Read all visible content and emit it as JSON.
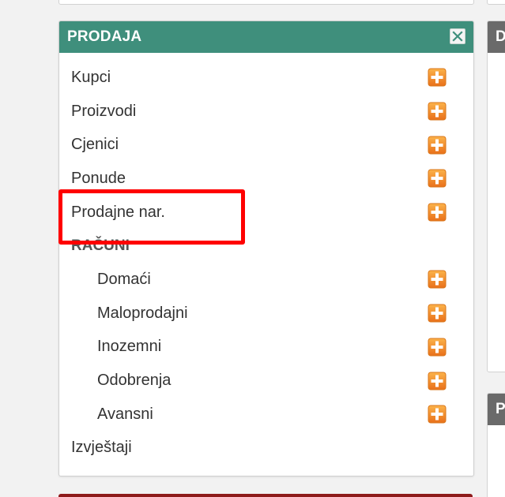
{
  "panel": {
    "title": "PRODAJA",
    "close_icon": "close-icon",
    "header_color": "#3f8f7c",
    "items": [
      {
        "label": "Kupci",
        "add_icon": "plus-icon",
        "type": "item"
      },
      {
        "label": "Proizvodi",
        "add_icon": "plus-icon",
        "type": "item"
      },
      {
        "label": "Cjenici",
        "add_icon": "plus-icon",
        "type": "item"
      },
      {
        "label": "Ponude",
        "add_icon": "plus-icon",
        "type": "item"
      },
      {
        "label": "Prodajne nar.",
        "add_icon": "plus-icon",
        "type": "item"
      },
      {
        "label": "RAČUNI",
        "type": "section"
      },
      {
        "label": "Domaći",
        "add_icon": "plus-icon",
        "type": "subitem"
      },
      {
        "label": "Maloprodajni",
        "add_icon": "plus-icon",
        "type": "subitem"
      },
      {
        "label": "Inozemni",
        "add_icon": "plus-icon",
        "type": "subitem"
      },
      {
        "label": "Odobrenja",
        "add_icon": "plus-icon",
        "type": "subitem"
      },
      {
        "label": "Avansni",
        "add_icon": "plus-icon",
        "type": "subitem"
      },
      {
        "label": "Izvještaji",
        "type": "item"
      }
    ]
  },
  "right_panels": {
    "top_initial": "D",
    "bottom_initial": "P",
    "header_color": "#6a6a6a"
  },
  "annotation": {
    "color": "#ff0000"
  },
  "colors": {
    "plus_orange": "#f08a1c",
    "bottom_panel": "#8e1b1b"
  }
}
